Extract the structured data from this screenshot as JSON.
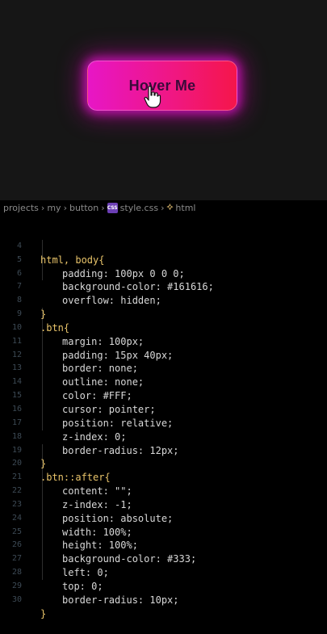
{
  "preview": {
    "button_label": "Hover Me",
    "gradient_colors": [
      "#e716c6",
      "#f0177f",
      "#f5164a"
    ],
    "background": "#161616"
  },
  "breadcrumb": {
    "items": [
      "projects",
      "my",
      "button",
      "style.css",
      "html"
    ]
  },
  "code": {
    "lines": [
      {
        "n": "4",
        "text": "html, body{"
      },
      {
        "n": "5",
        "text": "padding: 100px 0 0 0;"
      },
      {
        "n": "6",
        "text": "background-color: #161616;"
      },
      {
        "n": "7",
        "text": "overflow: hidden;"
      },
      {
        "n": "8",
        "text": "}"
      },
      {
        "n": "9",
        "text": ".btn{"
      },
      {
        "n": "10",
        "text": "margin: 100px;"
      },
      {
        "n": "11",
        "text": "padding: 15px 40px;"
      },
      {
        "n": "12",
        "text": "border: none;"
      },
      {
        "n": "13",
        "text": "outline: none;"
      },
      {
        "n": "14",
        "text": "color: #FFF;"
      },
      {
        "n": "15",
        "text": "cursor: pointer;"
      },
      {
        "n": "16",
        "text": "position: relative;"
      },
      {
        "n": "17",
        "text": "z-index: 0;"
      },
      {
        "n": "18",
        "text": "border-radius: 12px;"
      },
      {
        "n": "19",
        "text": "}"
      },
      {
        "n": "20",
        "text": ".btn::after{"
      },
      {
        "n": "21",
        "text": "content: \"\";"
      },
      {
        "n": "22",
        "text": "z-index: -1;"
      },
      {
        "n": "23",
        "text": "position: absolute;"
      },
      {
        "n": "24",
        "text": "width: 100%;"
      },
      {
        "n": "25",
        "text": "height: 100%;"
      },
      {
        "n": "26",
        "text": "background-color: #333;"
      },
      {
        "n": "27",
        "text": "left: 0;"
      },
      {
        "n": "28",
        "text": "top: 0;"
      },
      {
        "n": "29",
        "text": "border-radius: 10px;"
      },
      {
        "n": "30",
        "text": "}"
      }
    ]
  }
}
